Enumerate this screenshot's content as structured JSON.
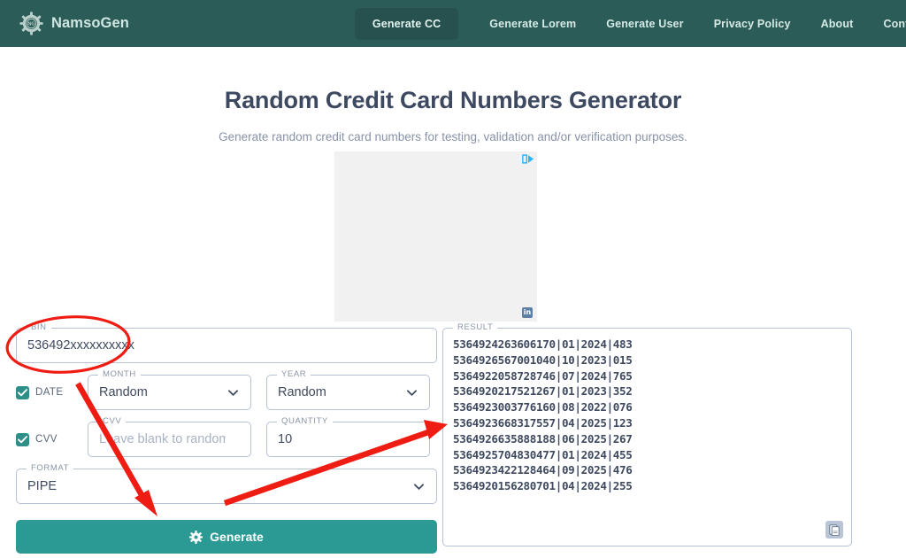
{
  "nav": {
    "brand": "NamsoGen",
    "logo_icon": "gear-icon",
    "links": [
      {
        "label": "Generate CC",
        "active": true
      },
      {
        "label": "Generate Lorem",
        "active": false
      },
      {
        "label": "Generate User",
        "active": false
      },
      {
        "label": "Privacy Policy",
        "active": false
      },
      {
        "label": "About",
        "active": false
      },
      {
        "label": "Contact",
        "active": false
      }
    ]
  },
  "hero": {
    "title": "Random Credit Card Numbers Generator",
    "subtitle": "Generate random credit card numbers for testing, validation and/or verification purposes."
  },
  "ad": {
    "adchoices_icon": "adchoices-icon",
    "linkedin_icon": "linkedin-icon",
    "linkedin_label": "in"
  },
  "form": {
    "bin": {
      "legend": "BIN",
      "value": "536492xxxxxxxxxx",
      "placeholder": ""
    },
    "date": {
      "checkbox_label": "DATE",
      "checked": true
    },
    "month": {
      "legend": "MONTH",
      "value": "Random"
    },
    "year": {
      "legend": "YEAR",
      "value": "Random"
    },
    "cvv": {
      "checkbox_label": "CVV",
      "checked": true
    },
    "cvv_field": {
      "legend": "CVV",
      "value": "",
      "placeholder": "Leave blank to randomize"
    },
    "quantity": {
      "legend": "QUANTITY",
      "value": "10"
    },
    "format": {
      "legend": "FORMAT",
      "value": "PIPE"
    },
    "generate_button": {
      "label": "Generate",
      "icon": "gear-icon"
    }
  },
  "result": {
    "legend": "RESULT",
    "copy_icon": "copy-document-icon",
    "lines": [
      "5364924263606170|01|2024|483",
      "5364926567001040|10|2023|015",
      "5364922058728746|07|2024|765",
      "5364920217521267|01|2023|352",
      "5364923003776160|08|2022|076",
      "5364923668317557|04|2025|123",
      "5364926635888188|06|2025|267",
      "5364925704830477|01|2024|455",
      "5364923422128464|09|2025|476",
      "5364920156280701|04|2024|255"
    ]
  },
  "annotations": {
    "color": "#ee1c12",
    "ellipse_target": "bin-field",
    "arrow1_target": "generate-button",
    "arrow2_target": "result-box"
  },
  "colors": {
    "nav_bg": "#2c5c58",
    "nav_active": "#27514e",
    "button_teal": "#2b9a94",
    "checkbox_teal": "#2e8f88",
    "title": "#3d4861",
    "field_border": "#b6c2d4"
  }
}
